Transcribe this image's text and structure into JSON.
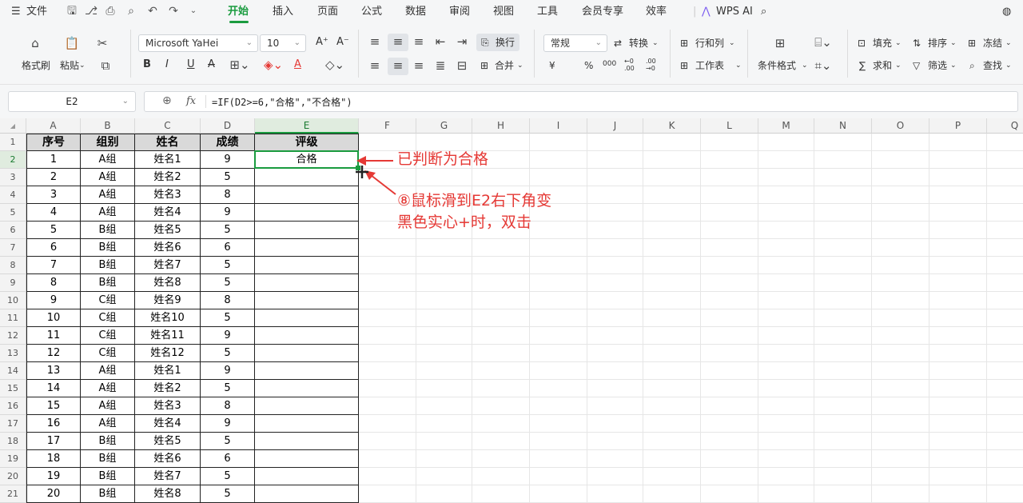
{
  "menubar": {
    "file": "文件",
    "tabs": [
      "开始",
      "插入",
      "页面",
      "公式",
      "数据",
      "审阅",
      "视图",
      "工具",
      "会员专享",
      "效率"
    ],
    "ai": "WPS AI"
  },
  "ribbon": {
    "format_painter": "格式刷",
    "paste": "粘贴",
    "font": "Microsoft YaHei",
    "size": "10",
    "wrap": "换行",
    "merge": "合并",
    "number_format": "常规",
    "convert": "转换",
    "rows_cols": "行和列",
    "worksheet": "工作表",
    "conditional": "条件格式",
    "fill": "填充",
    "sort": "排序",
    "freeze": "冻结",
    "sum": "求和",
    "filter": "筛选",
    "find": "查找",
    "bold": "B",
    "italic": "I",
    "underline": "U",
    "strike": "A",
    "font_color": "A",
    "grow": "A⁺",
    "shrink": "A⁻",
    "currency": "¥",
    "percent": "%",
    "thousands": "000",
    "dec_inc": "←0 .00",
    "dec_dec": ".00 →0"
  },
  "formula_bar": {
    "cell_ref": "E2",
    "fx": "fx",
    "formula": "=IF(D2>=6,\"合格\",\"不合格\")"
  },
  "sheet": {
    "columns": [
      "A",
      "B",
      "C",
      "D",
      "E",
      "F",
      "G",
      "H",
      "I",
      "J",
      "K",
      "L",
      "M",
      "N",
      "O",
      "P",
      "Q"
    ],
    "row_numbers": [
      "1",
      "2",
      "3",
      "4",
      "5",
      "6",
      "7",
      "8",
      "9",
      "10",
      "11",
      "12",
      "13",
      "14",
      "15",
      "16",
      "17",
      "18",
      "19",
      "20",
      "21"
    ],
    "header": [
      "序号",
      "组别",
      "姓名",
      "成绩",
      "评级"
    ],
    "rows": [
      [
        "1",
        "A组",
        "姓名1",
        "9",
        "合格"
      ],
      [
        "2",
        "A组",
        "姓名2",
        "5",
        ""
      ],
      [
        "3",
        "A组",
        "姓名3",
        "8",
        ""
      ],
      [
        "4",
        "A组",
        "姓名4",
        "9",
        ""
      ],
      [
        "5",
        "B组",
        "姓名5",
        "5",
        ""
      ],
      [
        "6",
        "B组",
        "姓名6",
        "6",
        ""
      ],
      [
        "7",
        "B组",
        "姓名7",
        "5",
        ""
      ],
      [
        "8",
        "B组",
        "姓名8",
        "5",
        ""
      ],
      [
        "9",
        "C组",
        "姓名9",
        "8",
        ""
      ],
      [
        "10",
        "C组",
        "姓名10",
        "5",
        ""
      ],
      [
        "11",
        "C组",
        "姓名11",
        "9",
        ""
      ],
      [
        "12",
        "C组",
        "姓名12",
        "5",
        ""
      ],
      [
        "13",
        "A组",
        "姓名1",
        "9",
        ""
      ],
      [
        "14",
        "A组",
        "姓名2",
        "5",
        ""
      ],
      [
        "15",
        "A组",
        "姓名3",
        "8",
        ""
      ],
      [
        "16",
        "A组",
        "姓名4",
        "9",
        ""
      ],
      [
        "17",
        "B组",
        "姓名5",
        "5",
        ""
      ],
      [
        "18",
        "B组",
        "姓名6",
        "6",
        ""
      ],
      [
        "19",
        "B组",
        "姓名7",
        "5",
        ""
      ],
      [
        "20",
        "B组",
        "姓名8",
        "5",
        ""
      ]
    ],
    "selected_column": "E",
    "selected_row": "2"
  },
  "annotations": {
    "judged": "已判断为合格",
    "step_line1": "⑧鼠标滑到E2右下角变",
    "step_line2": "黑色实心+时，双击",
    "color": "#e53935"
  }
}
